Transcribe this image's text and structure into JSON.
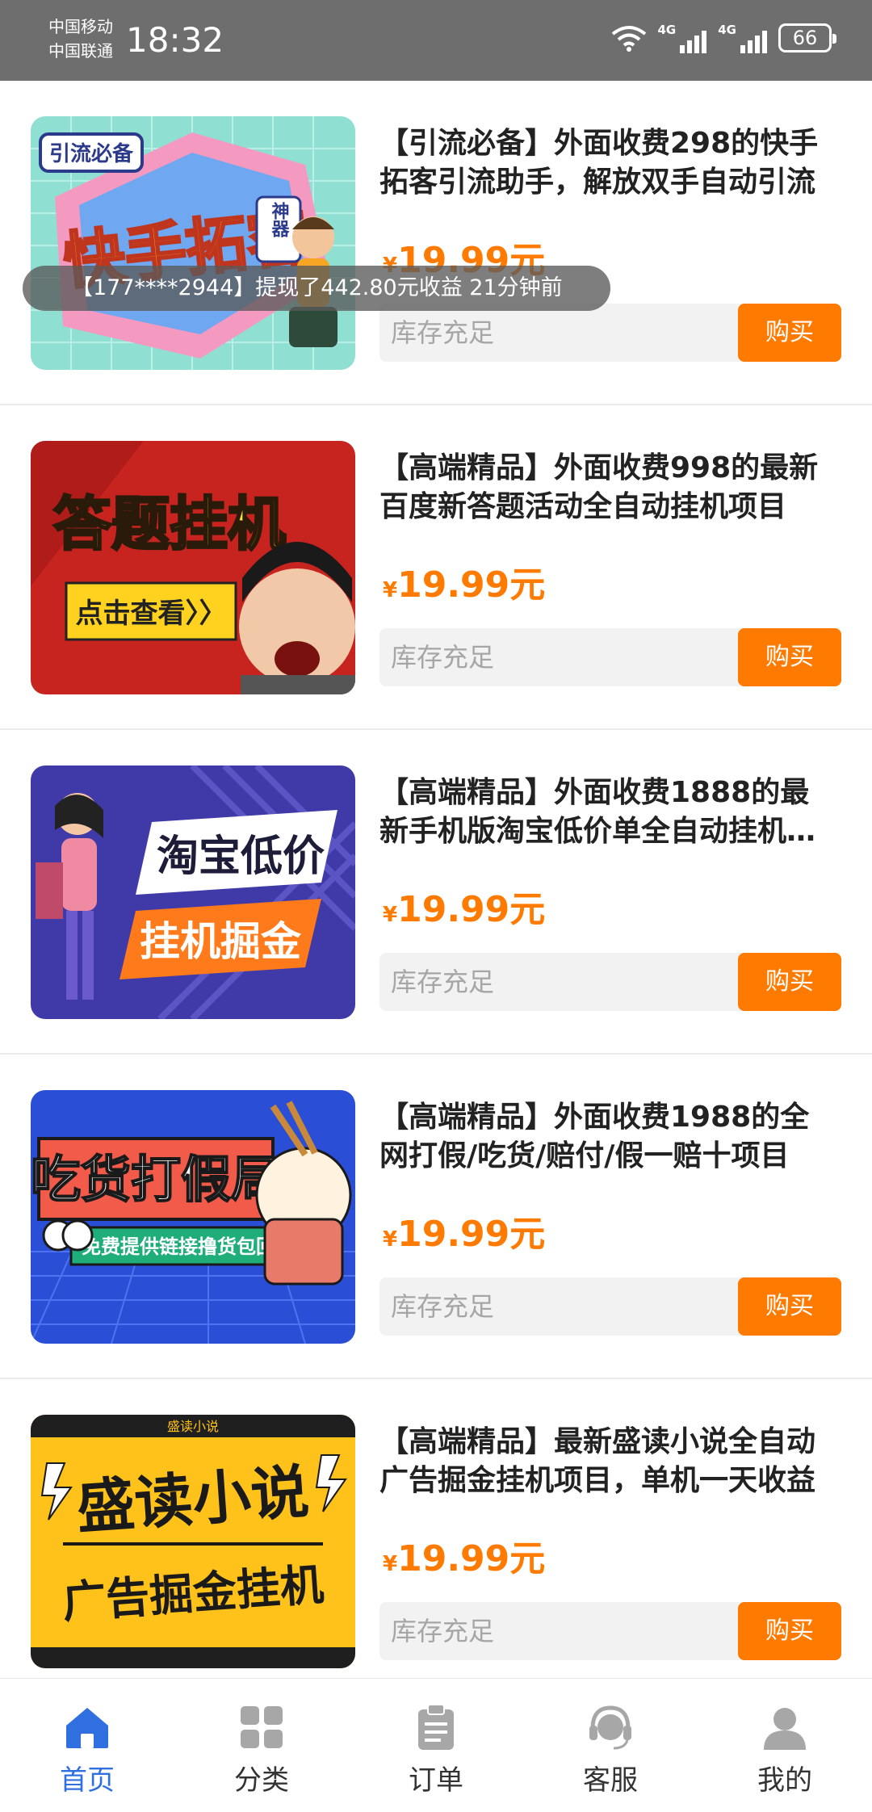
{
  "status_bar": {
    "carrier1": "中国移动",
    "carrier2": "中国联通",
    "time": "18:32",
    "network1": "4G",
    "network2": "4G",
    "battery": "66"
  },
  "toast": "【177****2944】提现了442.80元收益 21分钟前",
  "products": [
    {
      "title": "【引流必备】外面收费298的快手拓客引流助手，解放双手自动引流",
      "price_symbol": "¥",
      "price": "19.99元",
      "stock": "库存充足",
      "buy": "购买",
      "thumb": {
        "tag": "引流必备",
        "main": "快手拓客",
        "badge": "神器"
      }
    },
    {
      "title": "【高端精品】外面收费998的最新百度新答题活动全自动挂机项目",
      "price_symbol": "¥",
      "price": "19.99元",
      "stock": "库存充足",
      "buy": "购买",
      "thumb": {
        "main": "答题挂机",
        "sub": "点击查看〉〉"
      }
    },
    {
      "title": "【高端精品】外面收费1888的最新手机版淘宝低价单全自动挂机项目",
      "price_symbol": "¥",
      "price": "19.99元",
      "stock": "库存充足",
      "buy": "购买",
      "thumb": {
        "main": "淘宝低价",
        "sub": "挂机掘金"
      }
    },
    {
      "title": "【高端精品】外面收费1988的全网打假/吃货/赔付/假一赔十项目",
      "price_symbol": "¥",
      "price": "19.99元",
      "stock": "库存充足",
      "buy": "购买",
      "thumb": {
        "main": "吃货打假局",
        "sub": "免费提供链接撸货包回收"
      }
    },
    {
      "title": "【高端精品】最新盛读小说全自动广告掘金挂机项目，单机一天收益",
      "price_symbol": "¥",
      "price": "19.99元",
      "stock": "库存充足",
      "buy": "购买",
      "thumb": {
        "main": "盛读小说",
        "sub": "广告掘金挂机",
        "strip": "盛读小说"
      }
    }
  ],
  "tabs": [
    {
      "label": "首页",
      "icon": "home-icon",
      "active": true
    },
    {
      "label": "分类",
      "icon": "grid-icon",
      "active": false
    },
    {
      "label": "订单",
      "icon": "clipboard-icon",
      "active": false
    },
    {
      "label": "客服",
      "icon": "headset-icon",
      "active": false
    },
    {
      "label": "我的",
      "icon": "user-icon",
      "active": false
    }
  ],
  "colors": {
    "accent": "#ff7a00",
    "active_tab": "#2f6fe0",
    "status_bar": "#6e6e6e"
  }
}
